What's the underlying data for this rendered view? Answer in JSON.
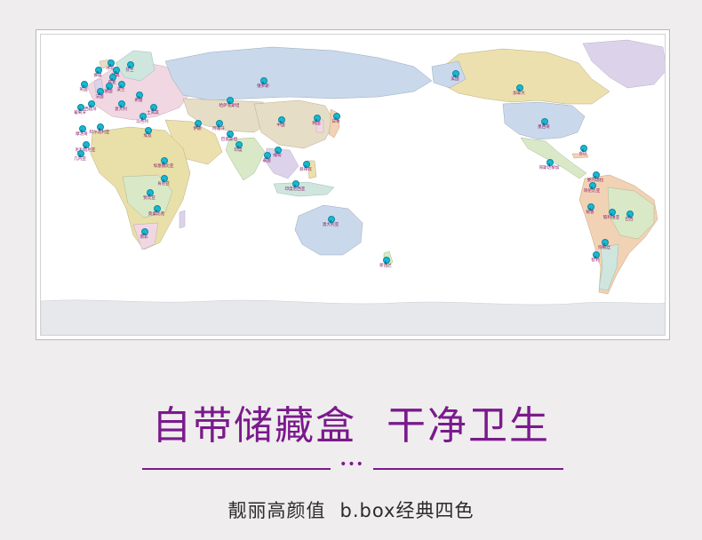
{
  "map": {
    "ocean_color": "#ffffff",
    "land_colors": [
      "#c9d8ea",
      "#e6ddc6",
      "#d9e9c7",
      "#f0d7e1",
      "#dcd3ea",
      "#e8e0a8",
      "#f2d2b4",
      "#cfe6df"
    ],
    "ice_color": "#e6e8ec",
    "marker_color": "#19b8d2",
    "label_color": "#8a1a6a",
    "labels": [
      "冰岛",
      "挪威",
      "瑞典",
      "芬兰",
      "英国",
      "丹麦",
      "德国",
      "法国",
      "波兰",
      "葡萄牙",
      "西班牙",
      "意大利",
      "希腊",
      "土耳其",
      "以色列",
      "埃及",
      "阿尔及利亚",
      "摩洛哥",
      "毛利塔尼亚",
      "几内亚",
      "俄罗斯",
      "哈萨克斯坦",
      "阿富汗",
      "伊朗",
      "巴基斯坦",
      "印度",
      "中国",
      "韩国",
      "日本",
      "缅甸",
      "泰国",
      "菲律宾",
      "印度尼西亚",
      "澳大利亚",
      "新西兰",
      "埃塞俄比亚",
      "肯尼亚",
      "赞比亚",
      "莫桑比克",
      "南非",
      "美国",
      "加拿大",
      "墨西哥",
      "古巴",
      "哥斯达黎加",
      "委内瑞拉",
      "哥伦比亚",
      "秘鲁",
      "玻利维亚",
      "巴西",
      "阿根廷",
      "智利"
    ]
  },
  "headline": {
    "left": "自带储藏盒",
    "right": "干净卫生"
  },
  "divider": {
    "dots": "•••"
  },
  "subline": {
    "left": "靓丽高颜值",
    "right": "b.box经典四色"
  }
}
